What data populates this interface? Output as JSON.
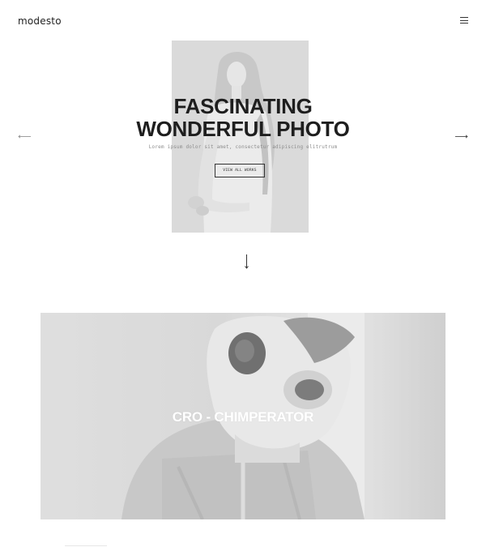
{
  "header": {
    "logo": "modesto",
    "menu_icon": "hamburger-menu-icon"
  },
  "hero": {
    "title_line1": "FASCINATING",
    "title_line2": "WONDERFUL PHOTO",
    "subtitle": "Lorem ipsum dolor sit amet, consectetur adipiscing elitrutrum",
    "button_label": "VIEW ALL WORKS",
    "prev_icon": "arrow-left-icon",
    "next_icon": "arrow-right-icon",
    "scroll_icon": "arrow-down-icon"
  },
  "project": {
    "title": "CRO - CHIMPERATOR"
  },
  "colors": {
    "text": "#1e1e1e",
    "background": "#ffffff",
    "photo_tint": "#d9d9d9"
  }
}
